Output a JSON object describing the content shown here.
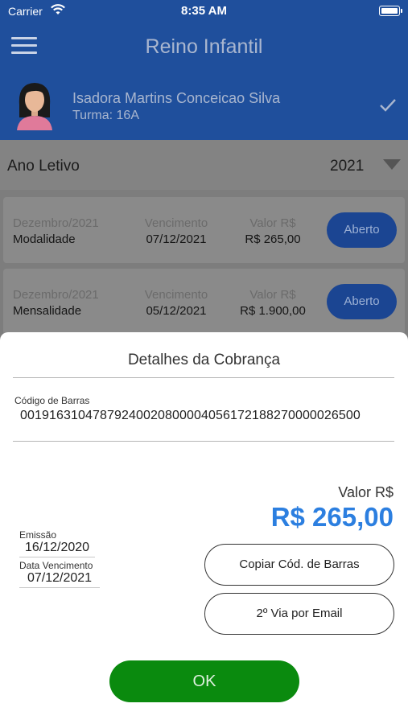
{
  "status_bar": {
    "carrier": "Carrier",
    "time": "8:35 AM"
  },
  "header": {
    "title": "Reino Infantil"
  },
  "student": {
    "name": "Isadora Martins Conceicao Silva",
    "class": "Turma: 16A"
  },
  "filter": {
    "label": "Ano Letivo",
    "selected_year": "2021"
  },
  "charges": [
    {
      "period": "Dezembro/2021",
      "type": "Modalidade",
      "due_label": "Vencimento",
      "due_date": "07/12/2021",
      "value_label": "Valor R$",
      "value": "R$ 265,00",
      "status": "Aberto"
    },
    {
      "period": "Dezembro/2021",
      "type": "Mensalidade",
      "due_label": "Vencimento",
      "due_date": "05/12/2021",
      "value_label": "Valor R$",
      "value": "R$ 1.900,00",
      "status": "Aberto"
    }
  ],
  "modal": {
    "title": "Detalhes da Cobrança",
    "barcode_label": "Código de Barras",
    "barcode": "00191631047879240020800004056172188270000026500",
    "value_label": "Valor R$",
    "value": "R$ 265,00",
    "issue_label": "Emissão",
    "issue_date": "16/12/2020",
    "due_label": "Data Vencimento",
    "due_date": "07/12/2021",
    "copy_button": "Copiar Cód. de Barras",
    "email_button": "2º Via por Email",
    "ok_button": "OK"
  },
  "colors": {
    "header_bg": "#1f4f9c",
    "accent_value": "#2c7fe0",
    "ok_green": "#0a8a0e"
  }
}
